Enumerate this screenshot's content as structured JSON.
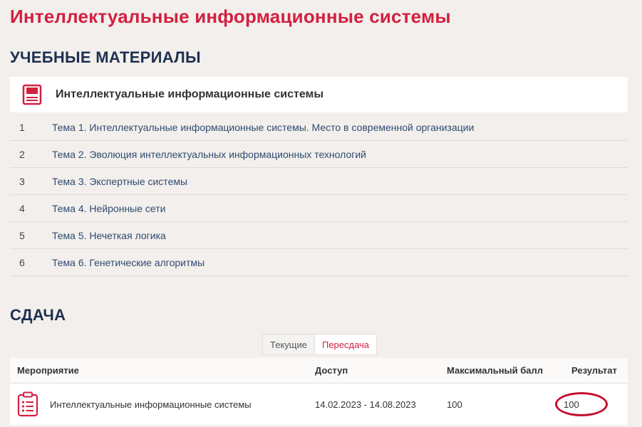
{
  "page": {
    "title": "Интеллектуальные информационные системы"
  },
  "materials": {
    "heading": "УЧЕБНЫЕ МАТЕРИАЛЫ",
    "course": {
      "name": "Интеллектуальные информационные системы",
      "icon": "book-icon"
    },
    "topics": [
      {
        "num": "1",
        "label": "Тема 1. Интеллектуальные информационные системы. Место в современной организации"
      },
      {
        "num": "2",
        "label": "Тема 2. Эволюция интеллектуальных информационных технологий"
      },
      {
        "num": "3",
        "label": "Тема 3. Экспертные системы"
      },
      {
        "num": "4",
        "label": "Тема 4. Нейронные сети"
      },
      {
        "num": "5",
        "label": "Тема 5. Нечеткая логика"
      },
      {
        "num": "6",
        "label": "Тема 6. Генетические алгоритмы"
      }
    ]
  },
  "submission": {
    "heading": "СДАЧА",
    "tabs": {
      "current": "Текущие",
      "retake": "Пересдача",
      "active": "retake"
    },
    "columns": {
      "event": "Мероприятие",
      "access": "Доступ",
      "max_score": "Максимальный балл",
      "result": "Результат"
    },
    "rows": [
      {
        "event": "Интеллектуальные информационные системы",
        "access": "14.02.2023 - 14.08.2023",
        "max_score": "100",
        "result": "100",
        "icon": "clipboard-list-icon"
      }
    ]
  },
  "colors": {
    "accent": "#d3203f",
    "heading": "#1d3050",
    "link": "#2f4b70",
    "background": "#f2efec",
    "highlight": "#c8102e"
  }
}
